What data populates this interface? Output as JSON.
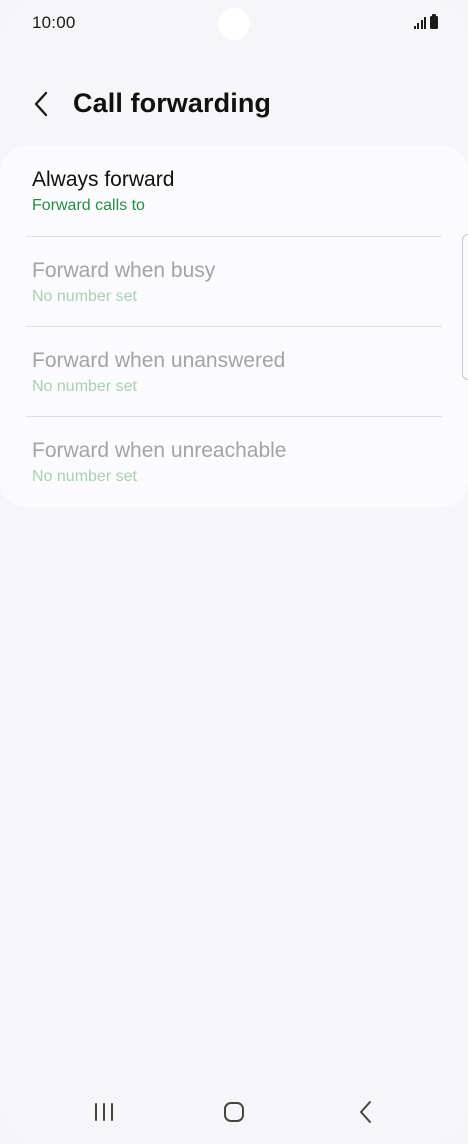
{
  "status_bar": {
    "time": "10:00",
    "icons": [
      "signal-icon",
      "battery-icon"
    ]
  },
  "header": {
    "back_icon": "chevron-left-icon",
    "title": "Call forwarding"
  },
  "list": [
    {
      "title": "Always forward",
      "subtitle": "Forward calls to",
      "enabled": true
    },
    {
      "title": "Forward when busy",
      "subtitle": "No number set",
      "enabled": false
    },
    {
      "title": "Forward when unanswered",
      "subtitle": "No number set",
      "enabled": false
    },
    {
      "title": "Forward when unreachable",
      "subtitle": "No number set",
      "enabled": false
    }
  ],
  "nav_bar": {
    "icons": [
      "recent-apps-icon",
      "home-icon",
      "back-icon"
    ]
  },
  "colors": {
    "background": "#f6f6f8",
    "card": "#fbfbfd",
    "accent_green": "#2a8a47",
    "disabled_text": "#a3a3a6",
    "disabled_sub": "#a9cfb4"
  }
}
